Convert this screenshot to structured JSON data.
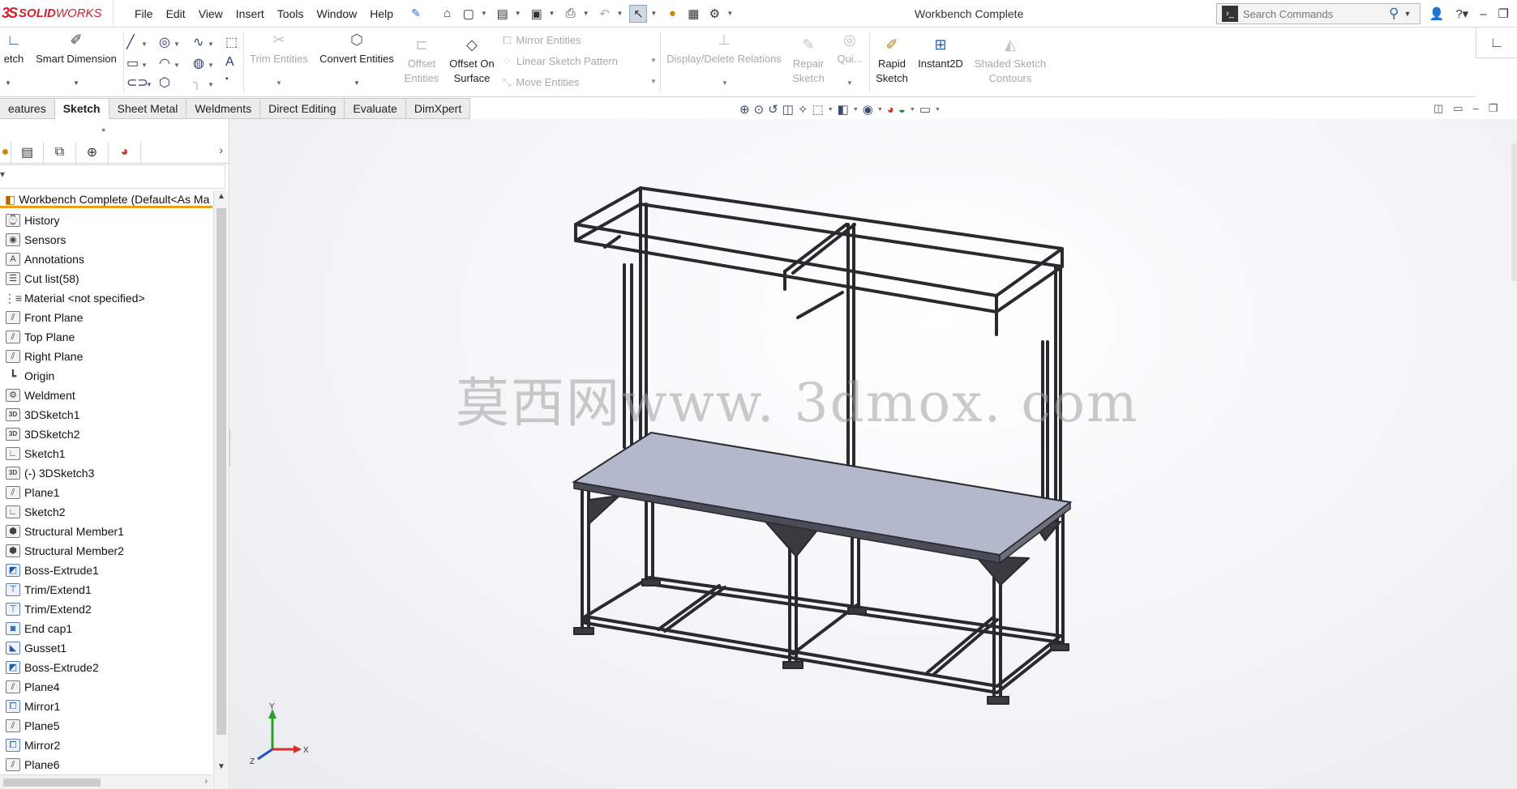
{
  "app": {
    "logo_ds": "3S",
    "logo_solid": "SOLID",
    "logo_works": "WORKS",
    "doc_title": "Workbench Complete"
  },
  "menu": [
    "File",
    "Edit",
    "View",
    "Insert",
    "Tools",
    "Window",
    "Help"
  ],
  "search": {
    "placeholder": "Search Commands"
  },
  "ribbon": {
    "sketch": "etch",
    "smart_dimension": "Smart Dimension",
    "trim_entities": "Trim Entities",
    "convert_entities": "Convert Entities",
    "offset_entities_1": "Offset",
    "offset_entities_2": "Entities",
    "offset_surface_1": "Offset On",
    "offset_surface_2": "Surface",
    "mirror_entities": "Mirror Entities",
    "linear_pattern": "Linear Sketch Pattern",
    "move_entities": "Move Entities",
    "display_delete": "Display/Delete Relations",
    "repair_1": "Repair",
    "repair_2": "Sketch",
    "quick": "Qui...",
    "rapid_1": "Rapid",
    "rapid_2": "Sketch",
    "instant2d": "Instant2D",
    "shaded_1": "Shaded Sketch",
    "shaded_2": "Contours"
  },
  "tabs": [
    {
      "label": "eatures",
      "active": false
    },
    {
      "label": "Sketch",
      "active": true
    },
    {
      "label": "Sheet Metal",
      "active": false
    },
    {
      "label": "Weldments",
      "active": false
    },
    {
      "label": "Direct Editing",
      "active": false
    },
    {
      "label": "Evaluate",
      "active": false
    },
    {
      "label": "DimXpert",
      "active": false
    }
  ],
  "tree": {
    "root": "Workbench Complete  (Default<As Ma",
    "items": [
      {
        "label": "History",
        "icon": "history-icon"
      },
      {
        "label": "Sensors",
        "icon": "sensor-icon"
      },
      {
        "label": "Annotations",
        "icon": "annotation-icon"
      },
      {
        "label": "Cut list(58)",
        "icon": "cut-list-icon"
      },
      {
        "label": "Material <not specified>",
        "icon": "material-icon"
      },
      {
        "label": "Front Plane",
        "icon": "plane-icon"
      },
      {
        "label": "Top Plane",
        "icon": "plane-icon"
      },
      {
        "label": "Right Plane",
        "icon": "plane-icon"
      },
      {
        "label": "Origin",
        "icon": "origin-icon"
      },
      {
        "label": "Weldment",
        "icon": "weldment-icon"
      },
      {
        "label": "3DSketch1",
        "icon": "3d-sketch-icon"
      },
      {
        "label": "3DSketch2",
        "icon": "3d-sketch-icon"
      },
      {
        "label": "Sketch1",
        "icon": "sketch-icon"
      },
      {
        "label": "(-) 3DSketch3",
        "icon": "3d-sketch-icon"
      },
      {
        "label": "Plane1",
        "icon": "plane-icon"
      },
      {
        "label": "Sketch2",
        "icon": "sketch-icon"
      },
      {
        "label": "Structural Member1",
        "icon": "structural-member-icon"
      },
      {
        "label": "Structural Member2",
        "icon": "structural-member-icon"
      },
      {
        "label": "Boss-Extrude1",
        "icon": "extrude-icon"
      },
      {
        "label": "Trim/Extend1",
        "icon": "trim-extend-icon"
      },
      {
        "label": "Trim/Extend2",
        "icon": "trim-extend-icon"
      },
      {
        "label": "End cap1",
        "icon": "end-cap-icon"
      },
      {
        "label": "Gusset1",
        "icon": "gusset-icon"
      },
      {
        "label": "Boss-Extrude2",
        "icon": "extrude-icon"
      },
      {
        "label": "Plane4",
        "icon": "plane-icon"
      },
      {
        "label": "Mirror1",
        "icon": "mirror-icon"
      },
      {
        "label": "Plane5",
        "icon": "plane-icon"
      },
      {
        "label": "Mirror2",
        "icon": "mirror-icon"
      },
      {
        "label": "Plane6",
        "icon": "plane-icon"
      }
    ]
  },
  "watermark": "莫西网www. 3dmox. com",
  "triad": {
    "x": "X",
    "y": "Y",
    "z": "Z"
  },
  "colors": {
    "brand": "#d3202f",
    "accent": "#2860a8",
    "selection": "#e7a21d"
  }
}
